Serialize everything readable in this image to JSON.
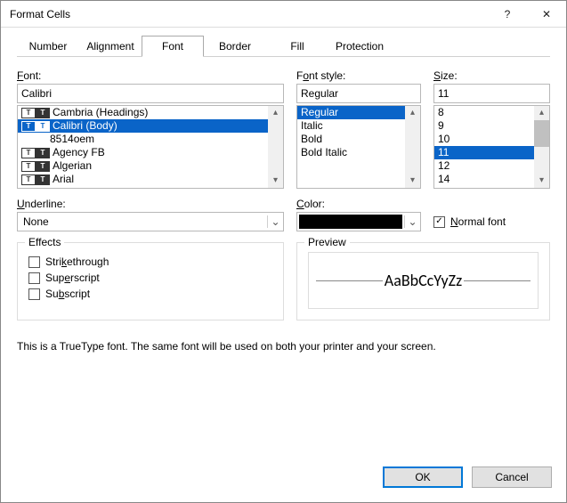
{
  "window": {
    "title": "Format Cells",
    "help": "?",
    "close": "✕"
  },
  "tabs": [
    "Number",
    "Alignment",
    "Font",
    "Border",
    "Fill",
    "Protection"
  ],
  "active_tab": "Font",
  "font": {
    "label_u": "F",
    "label_rest": "ont:",
    "value": "Calibri",
    "items": [
      {
        "name": "Cambria (Headings)",
        "tt": true,
        "indent": 0
      },
      {
        "name": "Calibri (Body)",
        "tt": true,
        "indent": 0,
        "selected": true
      },
      {
        "name": "8514oem",
        "tt": false,
        "indent": 1
      },
      {
        "name": "Agency FB",
        "tt": true,
        "indent": 0
      },
      {
        "name": "Algerian",
        "tt": true,
        "indent": 0
      },
      {
        "name": "Arial",
        "tt": true,
        "indent": 0
      }
    ]
  },
  "style": {
    "label_u": "o",
    "label_pre": "F",
    "label_post": "nt style:",
    "value": "Regular",
    "items": [
      "Regular",
      "Italic",
      "Bold",
      "Bold Italic"
    ],
    "selected": "Regular"
  },
  "size": {
    "label_u": "S",
    "label_rest": "ize:",
    "value": "11",
    "items": [
      "8",
      "9",
      "10",
      "11",
      "12",
      "14"
    ],
    "selected": "11"
  },
  "underline": {
    "label_u": "U",
    "label_rest": "nderline:",
    "value": "None"
  },
  "color": {
    "label_u": "C",
    "label_rest": "olor:",
    "swatch": "#000000"
  },
  "normal_font": {
    "checked": true,
    "label_u": "N",
    "label_rest": "ormal font"
  },
  "effects": {
    "legend": "Effects",
    "items": [
      {
        "u": "k",
        "pre": "Stri",
        "post": "ethrough",
        "checked": false
      },
      {
        "u": "e",
        "pre": "Sup",
        "post": "rscript",
        "checked": false
      },
      {
        "u": "b",
        "pre": "Su",
        "post": "script",
        "checked": false
      }
    ]
  },
  "preview": {
    "legend": "Preview",
    "text": "AaBbCcYyZz"
  },
  "note": "This is a TrueType font.  The same font will be used on both your printer and your screen.",
  "buttons": {
    "ok": "OK",
    "cancel": "Cancel"
  }
}
